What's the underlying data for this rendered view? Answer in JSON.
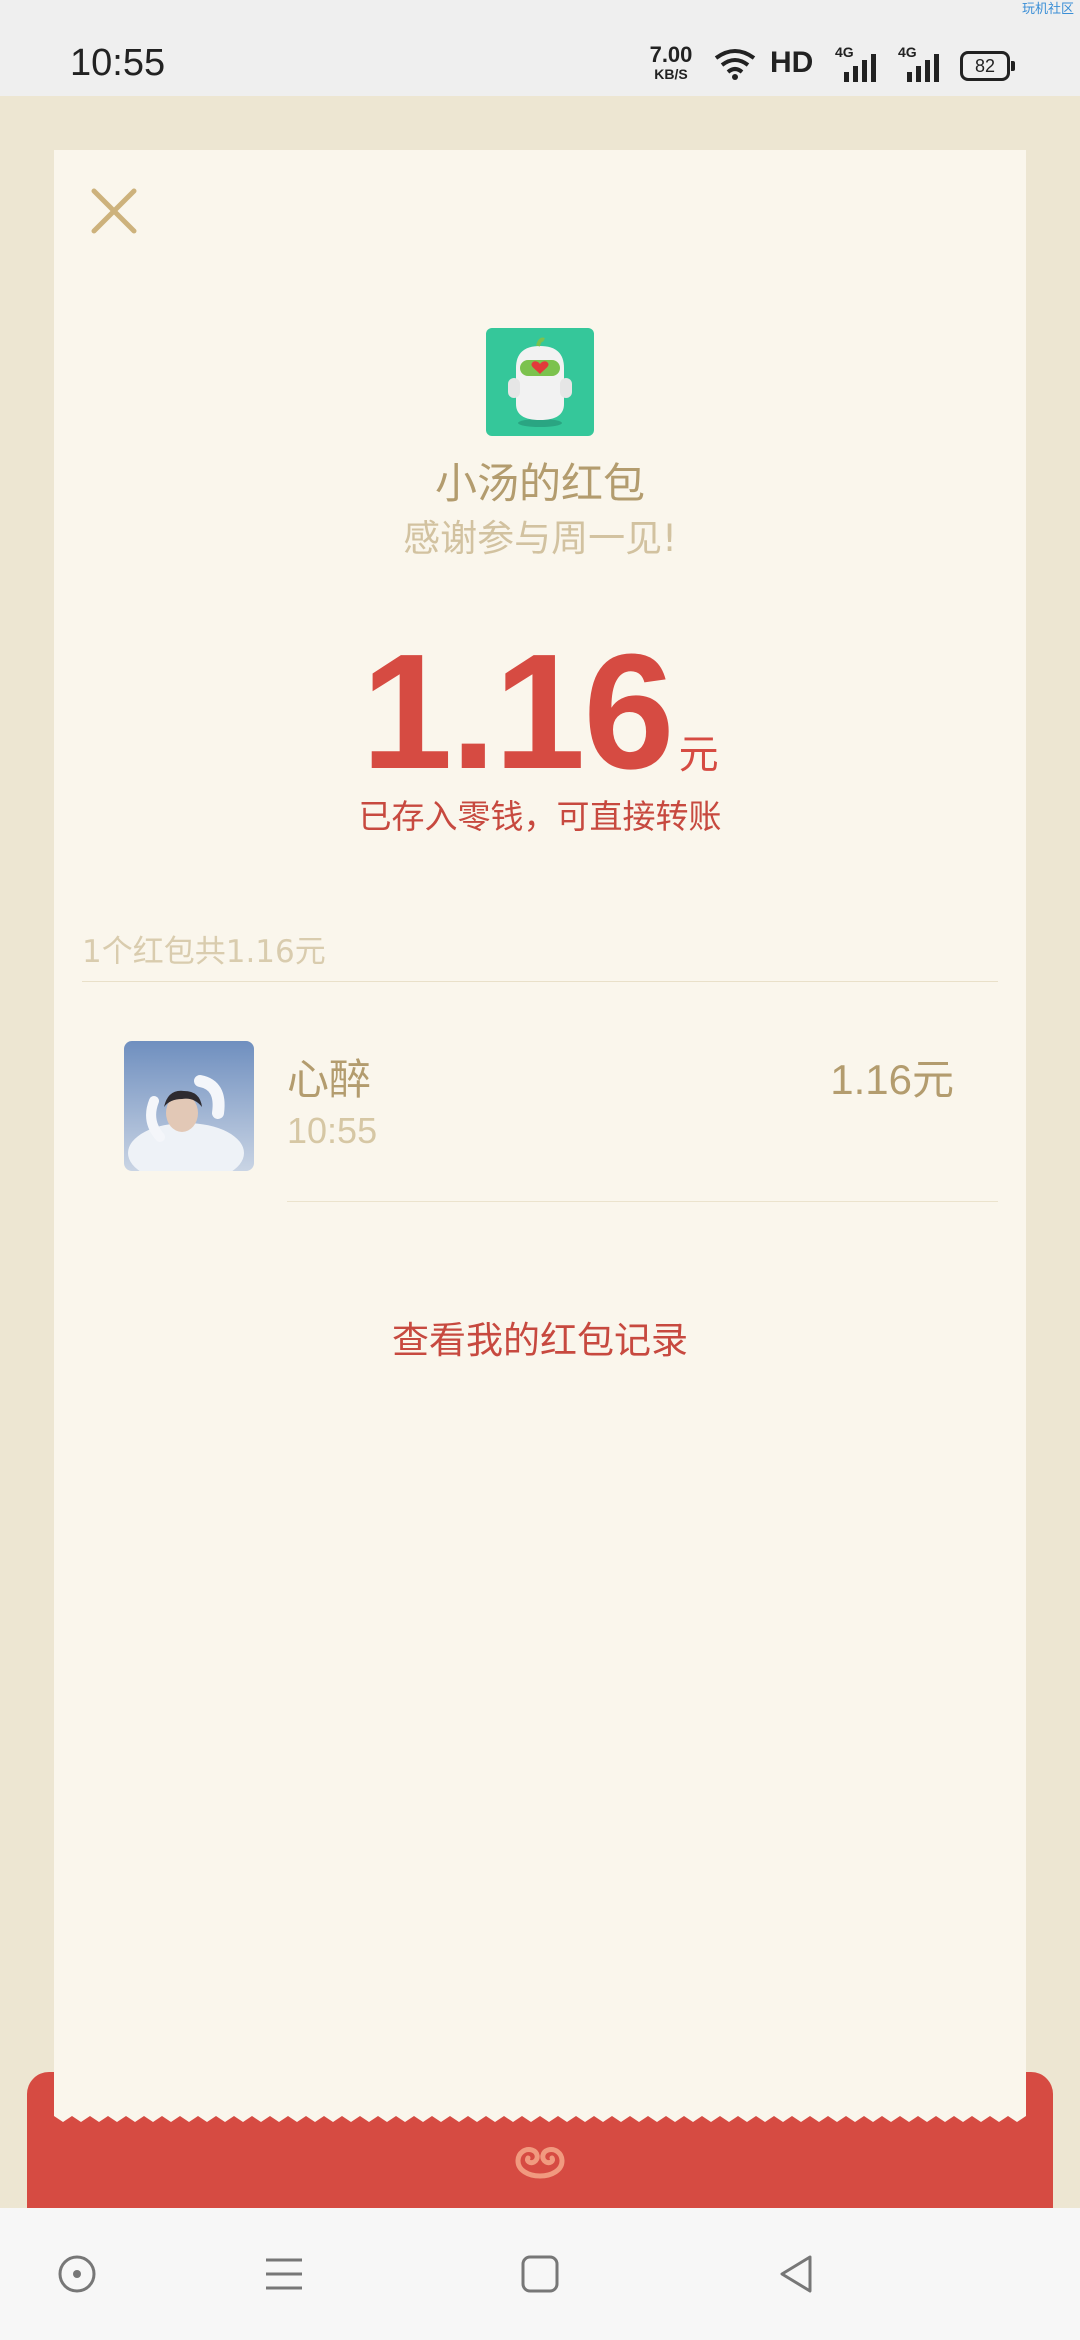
{
  "status_bar": {
    "time": "10:55",
    "net_speed_value": "7.00",
    "net_speed_unit": "KB/S",
    "hd_label": "HD",
    "signal_label_1": "4G",
    "signal_label_2": "4G",
    "battery": "82",
    "corner_text": "玩机社区"
  },
  "packet": {
    "sender_name": "小汤的红包",
    "greeting": "感谢参与周一见!",
    "amount": "1.16",
    "currency_unit": "元",
    "saved_note": "已存入零钱，可直接转账",
    "summary": "1个红包共1.16元"
  },
  "receivers": [
    {
      "name": "心醉",
      "time": "10:55",
      "amount": "1.16元"
    }
  ],
  "links": {
    "view_records": "查看我的红包记录"
  },
  "colors": {
    "accent_red": "#d64b42",
    "gold_text": "#b39c6e",
    "card_bg": "#faf6ec",
    "page_bg": "#ede6d2",
    "avatar_green": "#35c79a"
  },
  "icons": {
    "close": "close-icon",
    "nav_home_circle": "circle-dot-icon",
    "nav_menu": "menu-icon",
    "nav_home": "square-icon",
    "nav_back": "back-triangle-icon"
  }
}
